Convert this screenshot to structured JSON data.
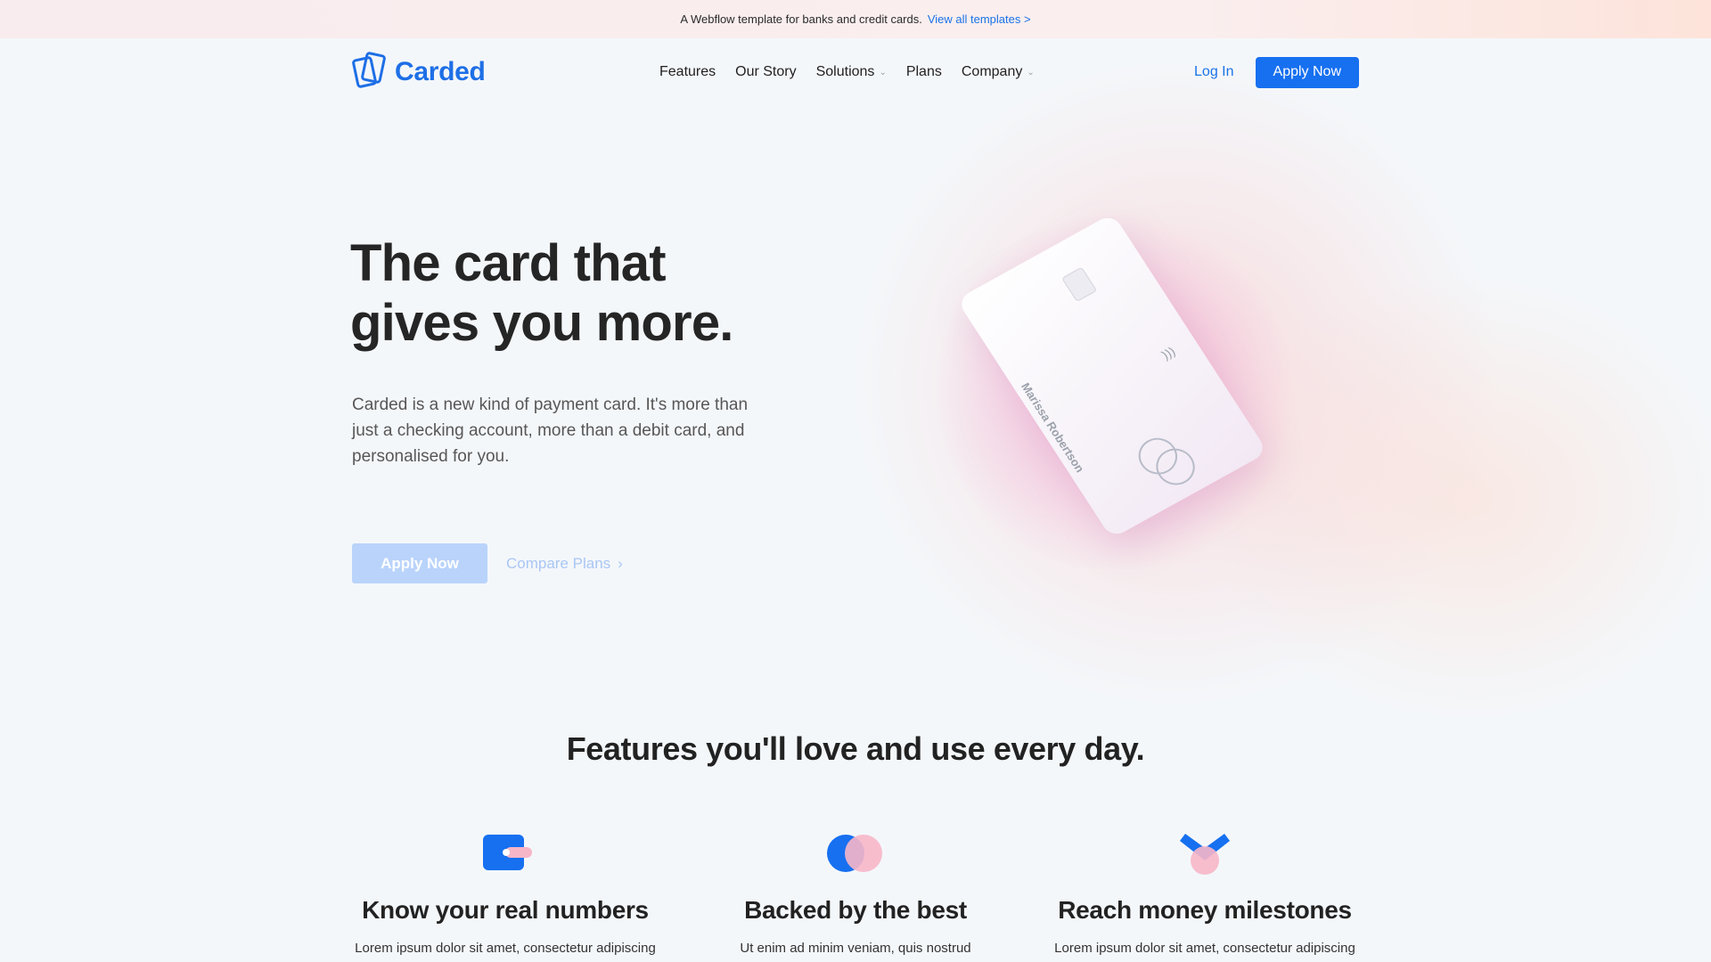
{
  "banner": {
    "text": "A Webflow template for banks and credit cards.",
    "link": "View all templates >"
  },
  "nav": {
    "logo": "Carded",
    "links": [
      "Features",
      "Our Story",
      "Solutions",
      "Plans",
      "Company"
    ],
    "login": "Log In",
    "apply": "Apply Now"
  },
  "hero": {
    "title_line1": "The card that",
    "title_line2": "gives you more.",
    "subtitle": "Carded is a new kind of payment card. It's more than just a checking account, more than a debit card, and personalised for you.",
    "apply": "Apply Now",
    "compare": "Compare Plans"
  },
  "card": {
    "name": "Marissa Robertson"
  },
  "features": {
    "title": "Features you'll love and use every day.",
    "items": [
      {
        "title": "Know your real numbers",
        "text": "Lorem ipsum dolor sit amet, consectetur adipiscing"
      },
      {
        "title": "Backed by the best",
        "text": "Ut enim ad minim veniam, quis nostrud"
      },
      {
        "title": "Reach money milestones",
        "text": "Lorem ipsum dolor sit amet, consectetur adipiscing"
      }
    ]
  },
  "colors": {
    "accent": "#1670f0",
    "accent_light": "#b9d3fb",
    "pink": "#f7b6c8"
  }
}
